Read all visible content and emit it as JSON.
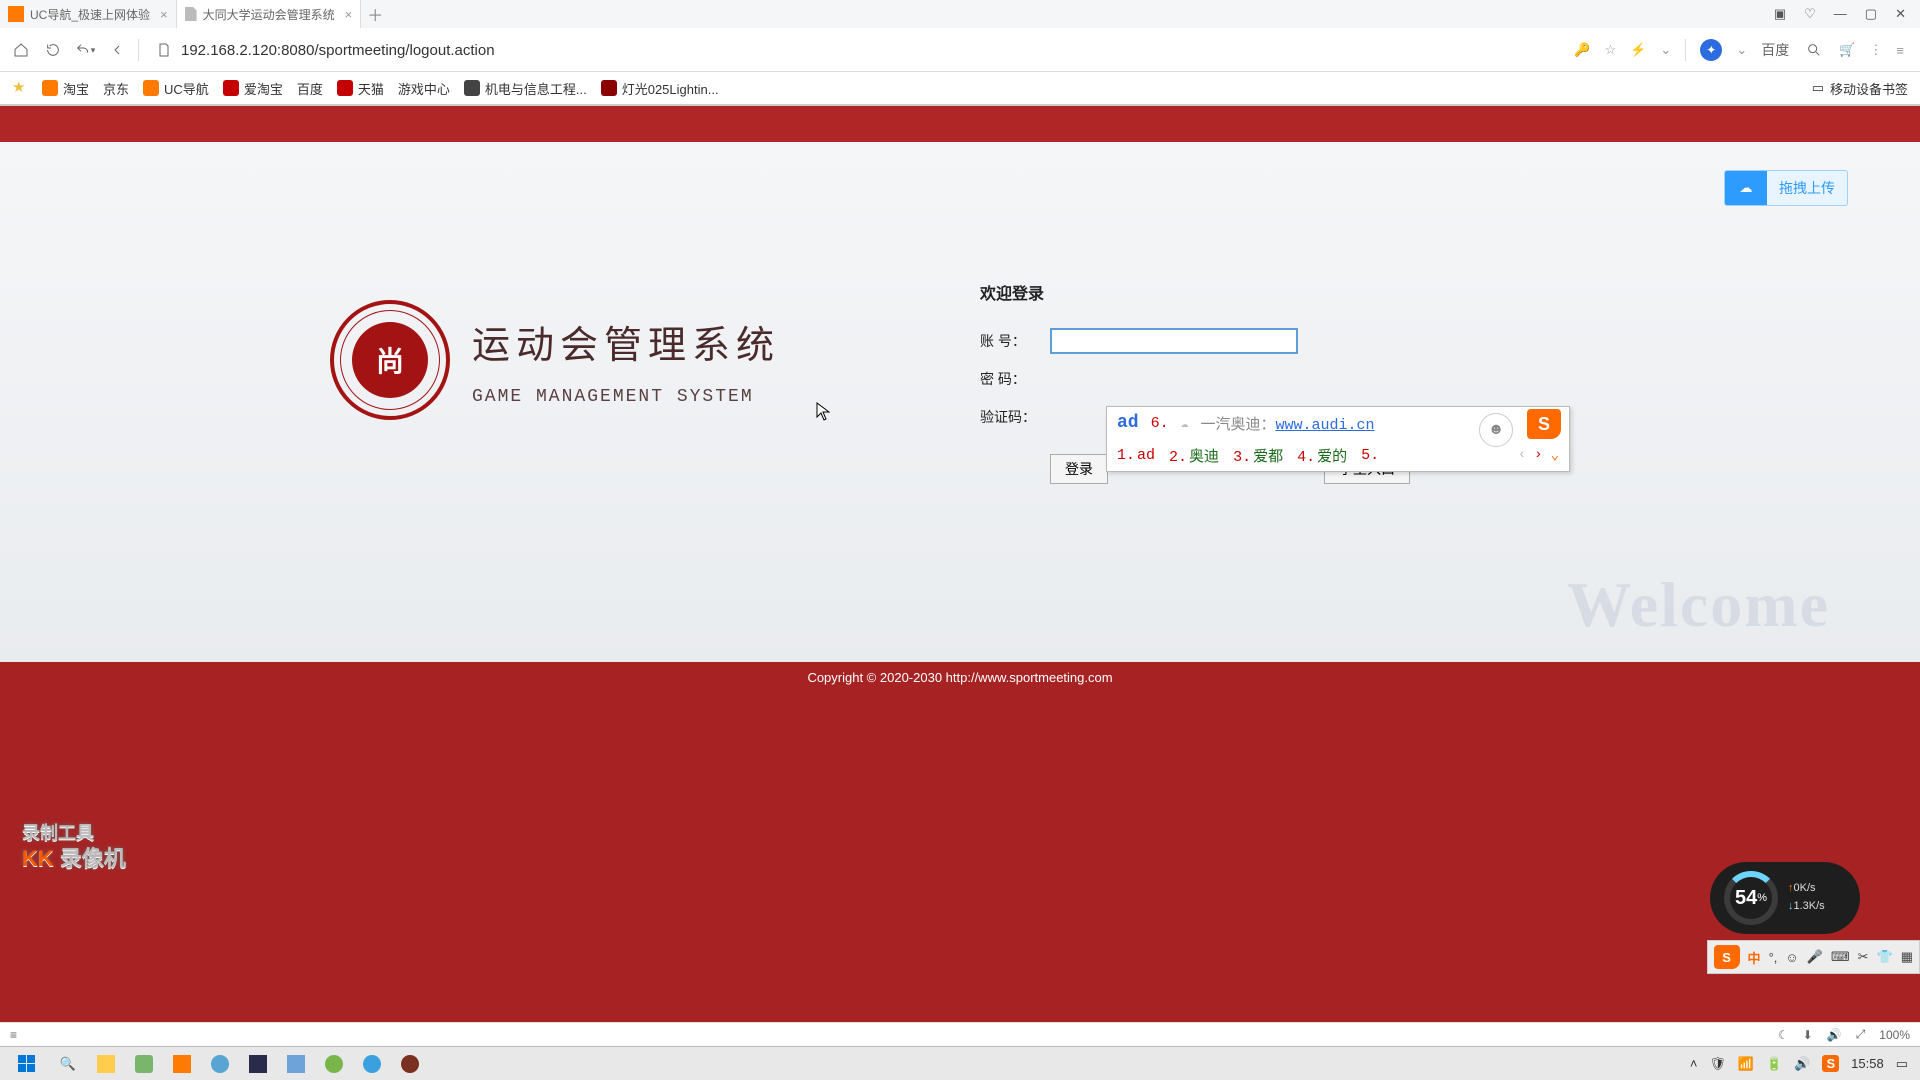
{
  "browser": {
    "tabs": [
      {
        "title": "UC导航_极速上网体验"
      },
      {
        "title": "大同大学运动会管理系统"
      }
    ],
    "url": "192.168.2.120:8080/sportmeeting/logout.action",
    "search_engine": "百度"
  },
  "bookmarks": {
    "items": [
      "淘宝",
      "京东",
      "UC导航",
      "爱淘宝",
      "百度",
      "天猫",
      "游戏中心",
      "机电与信息工程...",
      "灯光025Lightin..."
    ],
    "right": "移动设备书签"
  },
  "upload_chip": "拖拽上传",
  "brand": {
    "title_zh": "运动会管理系统",
    "title_en": "GAME MANAGEMENT SYSTEM",
    "seal_char": "尚"
  },
  "login": {
    "welcome": "欢迎登录",
    "label_account": "账 号：",
    "label_password": "密 码：",
    "label_captcha": "验证码：",
    "btn_login": "登录",
    "btn_student": "学生入口",
    "account_value": ""
  },
  "ime": {
    "composing": "ad",
    "hint_index": "6.",
    "hint_text": "一汽奥迪：",
    "hint_link": "www.audi.cn",
    "candidates": [
      {
        "n": "1.",
        "w": "ad"
      },
      {
        "n": "2.",
        "w": "奥迪"
      },
      {
        "n": "3.",
        "w": "爱都"
      },
      {
        "n": "4.",
        "w": "爱的"
      },
      {
        "n": "5.",
        "w": ""
      }
    ]
  },
  "ime_toolbar": [
    "中",
    "°,",
    "☺",
    "🎤",
    "⌨",
    "✂",
    "👕",
    "▦"
  ],
  "welcome_bg": "Welcome",
  "footer": "Copyright © 2020-2030 http://www.sportmeeting.com",
  "recorder": {
    "l1": "录制工具",
    "l2a": "KK",
    "l2b": " 录像机"
  },
  "netmon": {
    "pct": "54",
    "pct_unit": "%",
    "up": "0K/s",
    "down": "1.3K/s"
  },
  "statusbar": {
    "zoom": "100%"
  },
  "taskbar": {
    "time": "15:58"
  }
}
